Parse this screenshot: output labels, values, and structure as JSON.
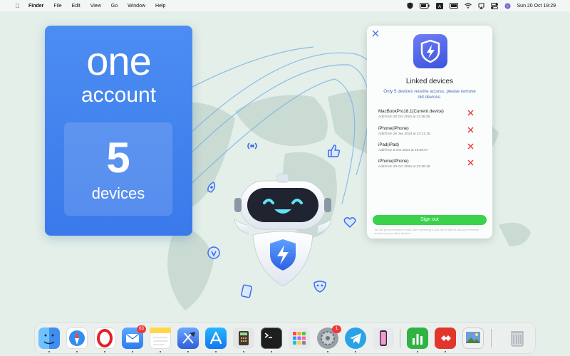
{
  "menubar": {
    "app_name": "Finder",
    "menus": [
      "File",
      "Edit",
      "View",
      "Go",
      "Window",
      "Help"
    ],
    "clock": "Sun 20 Oct  19:29",
    "status_icons": [
      "vpn-shield-icon",
      "battery-icon",
      "text-input-icon",
      "screen-mirror-icon",
      "wifi-icon",
      "airplay-icon",
      "control-center-icon",
      "siri-icon"
    ]
  },
  "promo": {
    "headline": "one",
    "subheadline": "account",
    "count": "5",
    "count_label": "devices"
  },
  "panel": {
    "title": "Linked devices",
    "note": "Only 5 devices receive access, please remove old devices.",
    "devices": [
      {
        "name": "MacBookPro18,1(Current device)",
        "date": "Add from 20 Oct 2024 at 22:36:36"
      },
      {
        "name": "iPhone(iPhone)",
        "date": "Add from 26 Jan 2024 at 23:21:15"
      },
      {
        "name": "iPad(iPad)",
        "date": "Add from 8 Oct 2024 at 19:56:07"
      },
      {
        "name": "iPhone(iPhone)",
        "date": "Add from 20 Oct 2024 at 22:26:18"
      }
    ],
    "signout_label": "Sign out",
    "footer": "You will get a verification email. After confirming it, you will be able to use your Premium account on your other devices.",
    "colors": {
      "accent": "#4a6db6",
      "signout": "#3ad24a",
      "remove": "#e03a2f"
    }
  },
  "dock": {
    "apps": [
      {
        "name": "Finder",
        "icon": "finder-icon",
        "color": "#3e9cf0"
      },
      {
        "name": "Safari",
        "icon": "safari-icon",
        "color": "#2f8ff0"
      },
      {
        "name": "Opera",
        "icon": "opera-icon",
        "color": "#ffffff"
      },
      {
        "name": "Mail",
        "icon": "mail-icon",
        "color": "#3b8cf5",
        "badge": "63"
      },
      {
        "name": "Notes",
        "icon": "notes-icon",
        "color": "#ffd84a"
      },
      {
        "name": "Xcode",
        "icon": "xcode-icon",
        "color": "#2f6fe0"
      },
      {
        "name": "App Store",
        "icon": "app-store-icon",
        "color": "#1e8ef5"
      },
      {
        "name": "Calculator",
        "icon": "calculator-icon",
        "color": "#3a3a3a"
      },
      {
        "name": "Terminal",
        "icon": "terminal-icon",
        "color": "#1e1e1e"
      },
      {
        "name": "Launchpad",
        "icon": "launchpad-icon",
        "color": "#d9dde2"
      },
      {
        "name": "System Settings",
        "icon": "settings-icon",
        "color": "#8a8f95",
        "badge": "1"
      },
      {
        "name": "Telegram",
        "icon": "telegram-icon",
        "color": "#2aa3e6"
      },
      {
        "name": "iPhone Mirroring",
        "icon": "iphone-mirroring-icon",
        "color": "#e6e8ec"
      },
      {
        "name": "Numbers",
        "icon": "numbers-icon",
        "color": "#2fb443"
      },
      {
        "name": "AnyDesk",
        "icon": "anydesk-icon",
        "color": "#e0362c"
      },
      {
        "name": "Preview",
        "icon": "preview-icon",
        "color": "#6d9ed8"
      },
      {
        "name": "Trash",
        "icon": "trash-icon",
        "color": "#c9cdd1"
      }
    ]
  }
}
